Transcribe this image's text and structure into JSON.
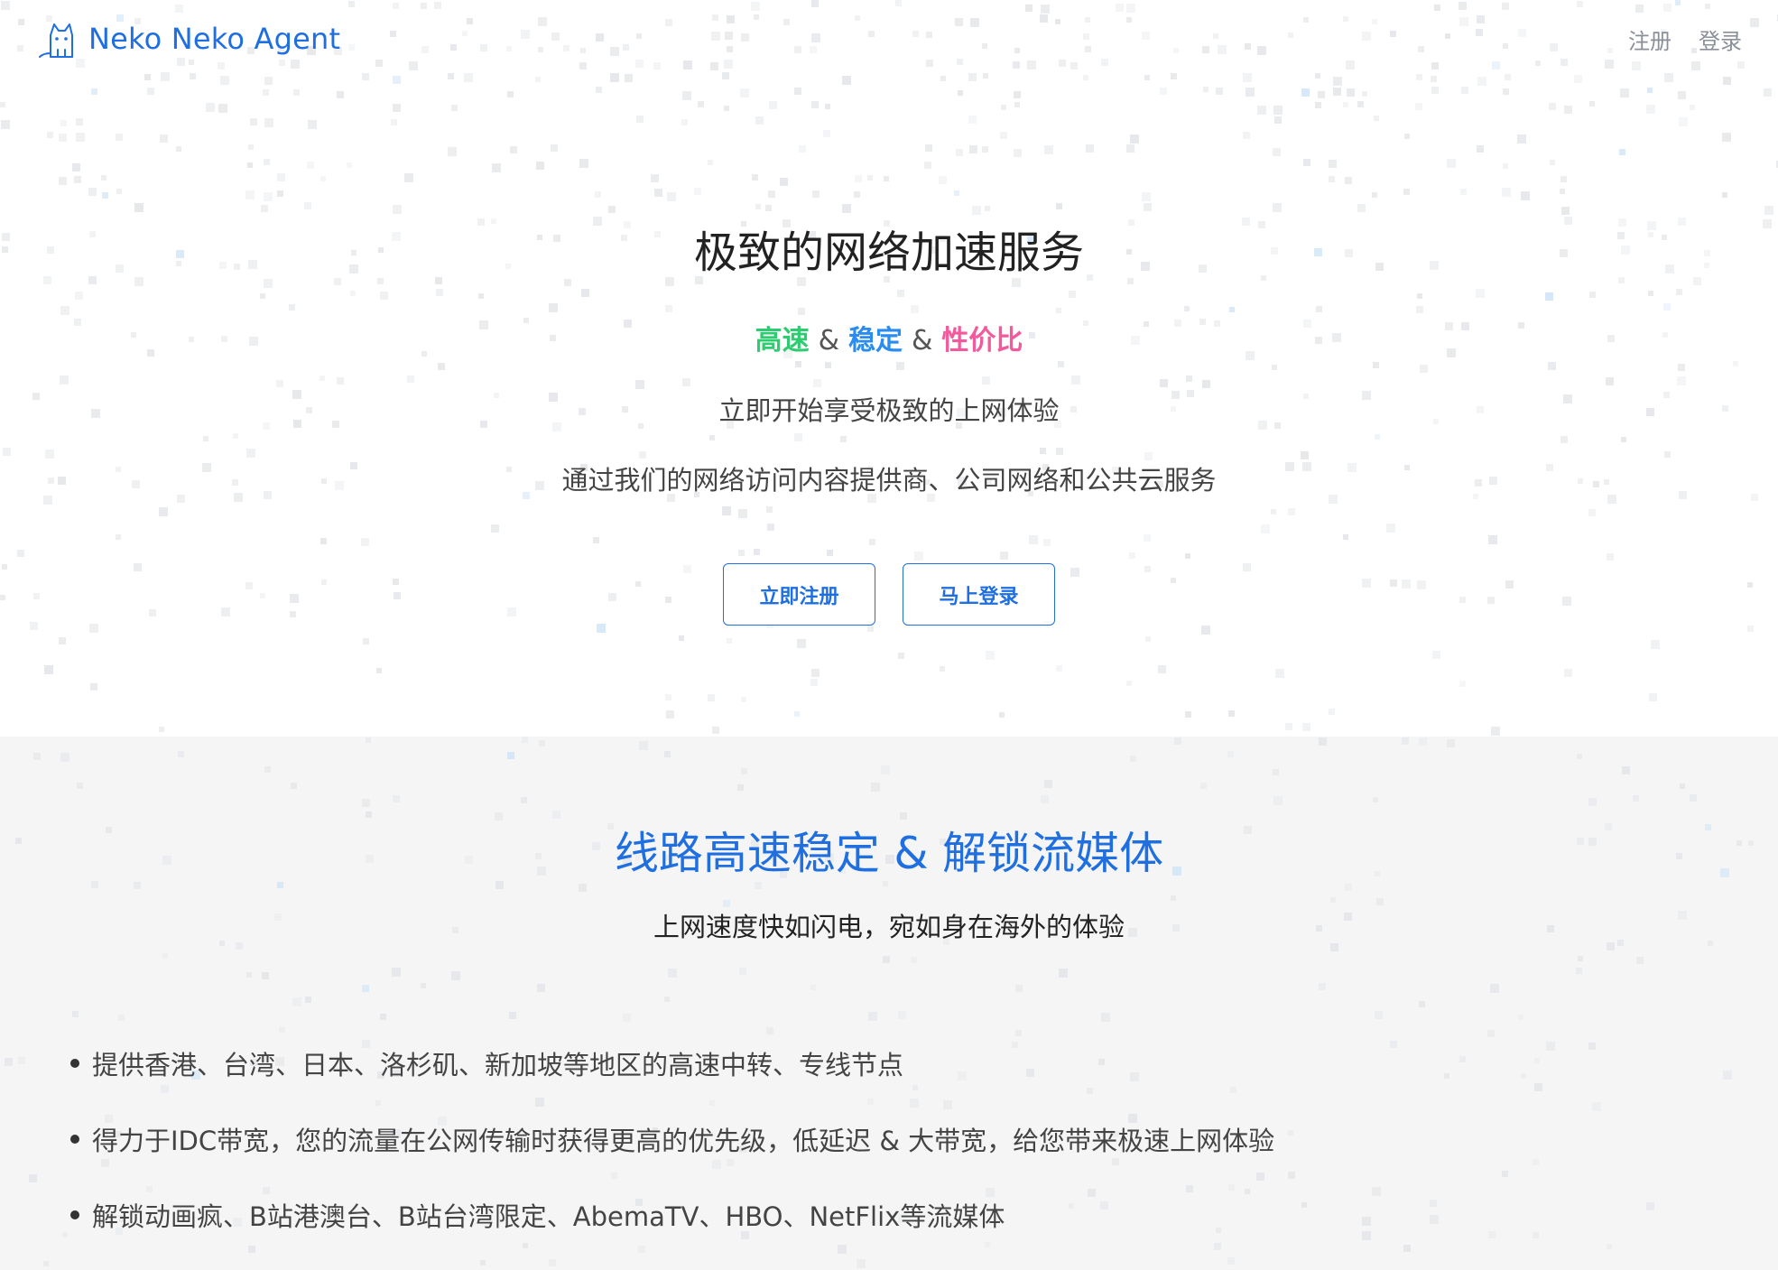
{
  "header": {
    "brand_name": "Neko Neko Agent",
    "logo_icon": "cat-icon",
    "nav": {
      "register": "注册",
      "login": "登录"
    }
  },
  "hero": {
    "title": "极致的网络加速服务",
    "tags": {
      "speed": "高速",
      "amp1": "&",
      "stable": "稳定",
      "amp2": "&",
      "value": "性价比"
    },
    "subtitle1": "立即开始享受极致的上网体验",
    "subtitle2": "通过我们的网络访问内容提供商、公司网络和公共云服务",
    "buttons": {
      "register": "立即注册",
      "login": "马上登录"
    }
  },
  "features": {
    "title": "线路高速稳定 & 解锁流媒体",
    "subtitle": "上网速度快如闪电，宛如身在海外的体验",
    "items": [
      "提供香港、台湾、日本、洛杉矶、新加坡等地区的高速中转、专线节点",
      "得力于IDC带宽，您的流量在公网传输时获得更高的优先级，低延迟 & 大带宽，给您带来极速上网体验",
      "解锁动画疯、B站港澳台、B站台湾限定、AbemaTV、HBO、NetFlix等流媒体"
    ]
  },
  "colors": {
    "brand_blue": "#1f6fe0",
    "speed_green": "#2ecc71",
    "stable_blue": "#2a8cf0",
    "value_pink": "#f25a9c",
    "section_bg": "#f5f5f6"
  }
}
